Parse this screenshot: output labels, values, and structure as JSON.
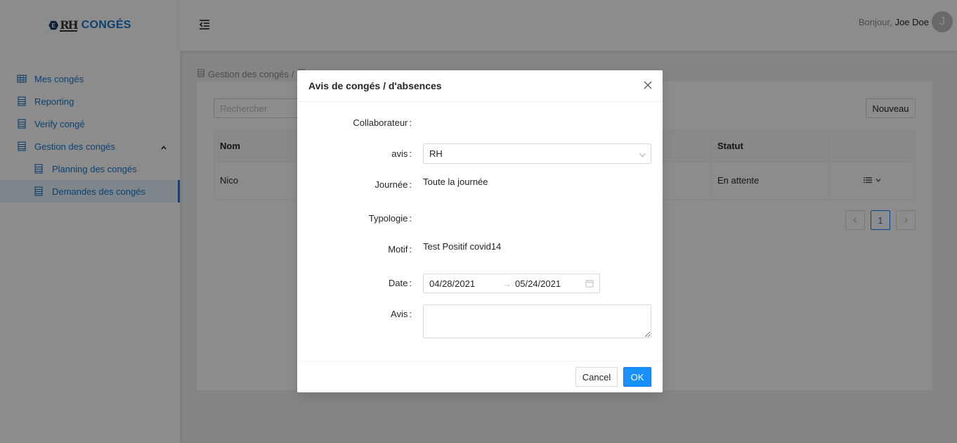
{
  "brand": {
    "logo_letters": "RH",
    "logo_badge": "E",
    "name": "CONGÉS"
  },
  "sidebar": {
    "items": [
      {
        "label": "Mes congés",
        "icon": "table-icon"
      },
      {
        "label": "Reporting",
        "icon": "document-icon"
      },
      {
        "label": "Verify congé",
        "icon": "document-icon"
      },
      {
        "label": "Gestion des congés",
        "icon": "document-icon",
        "expanded": true
      },
      {
        "label": "Planning des congés",
        "icon": "document-icon"
      },
      {
        "label": "Demandes des congés",
        "icon": "document-icon",
        "active": true
      }
    ]
  },
  "header": {
    "greeting": "Bonjour,",
    "user_name": "Joe Doe",
    "avatar_initial": "J"
  },
  "breadcrumb": {
    "first": "Gestion des congés",
    "separator": "/"
  },
  "content": {
    "search_placeholder": "Rechercher",
    "new_button": "Nouveau",
    "table": {
      "headers": {
        "nom": "Nom",
        "statut": "Statut"
      },
      "rows": [
        {
          "nom": "Nico",
          "statut": "En attente"
        }
      ]
    },
    "pagination": {
      "current_page": "1"
    }
  },
  "modal": {
    "title": "Avis de congés / d'absences",
    "fields": {
      "collaborateur": {
        "label": "Collaborateur",
        "value": ""
      },
      "avis_select": {
        "label": "avis",
        "value": "RH"
      },
      "journee": {
        "label": "Journée",
        "value": "Toute la journée"
      },
      "typologie": {
        "label": "Typologie",
        "value": ""
      },
      "motif": {
        "label": "Motif",
        "value": "Test Positif covid14"
      },
      "date": {
        "label": "Date",
        "start": "04/28/2021",
        "separator": "→",
        "end": "05/24/2021"
      },
      "avis_text": {
        "label": "Avis",
        "value": ""
      }
    },
    "colon": ":",
    "cancel": "Cancel",
    "ok": "OK"
  },
  "colors": {
    "primary": "#1890ff",
    "link": "#1677c8",
    "mask": "rgba(0,0,0,0.45)"
  }
}
